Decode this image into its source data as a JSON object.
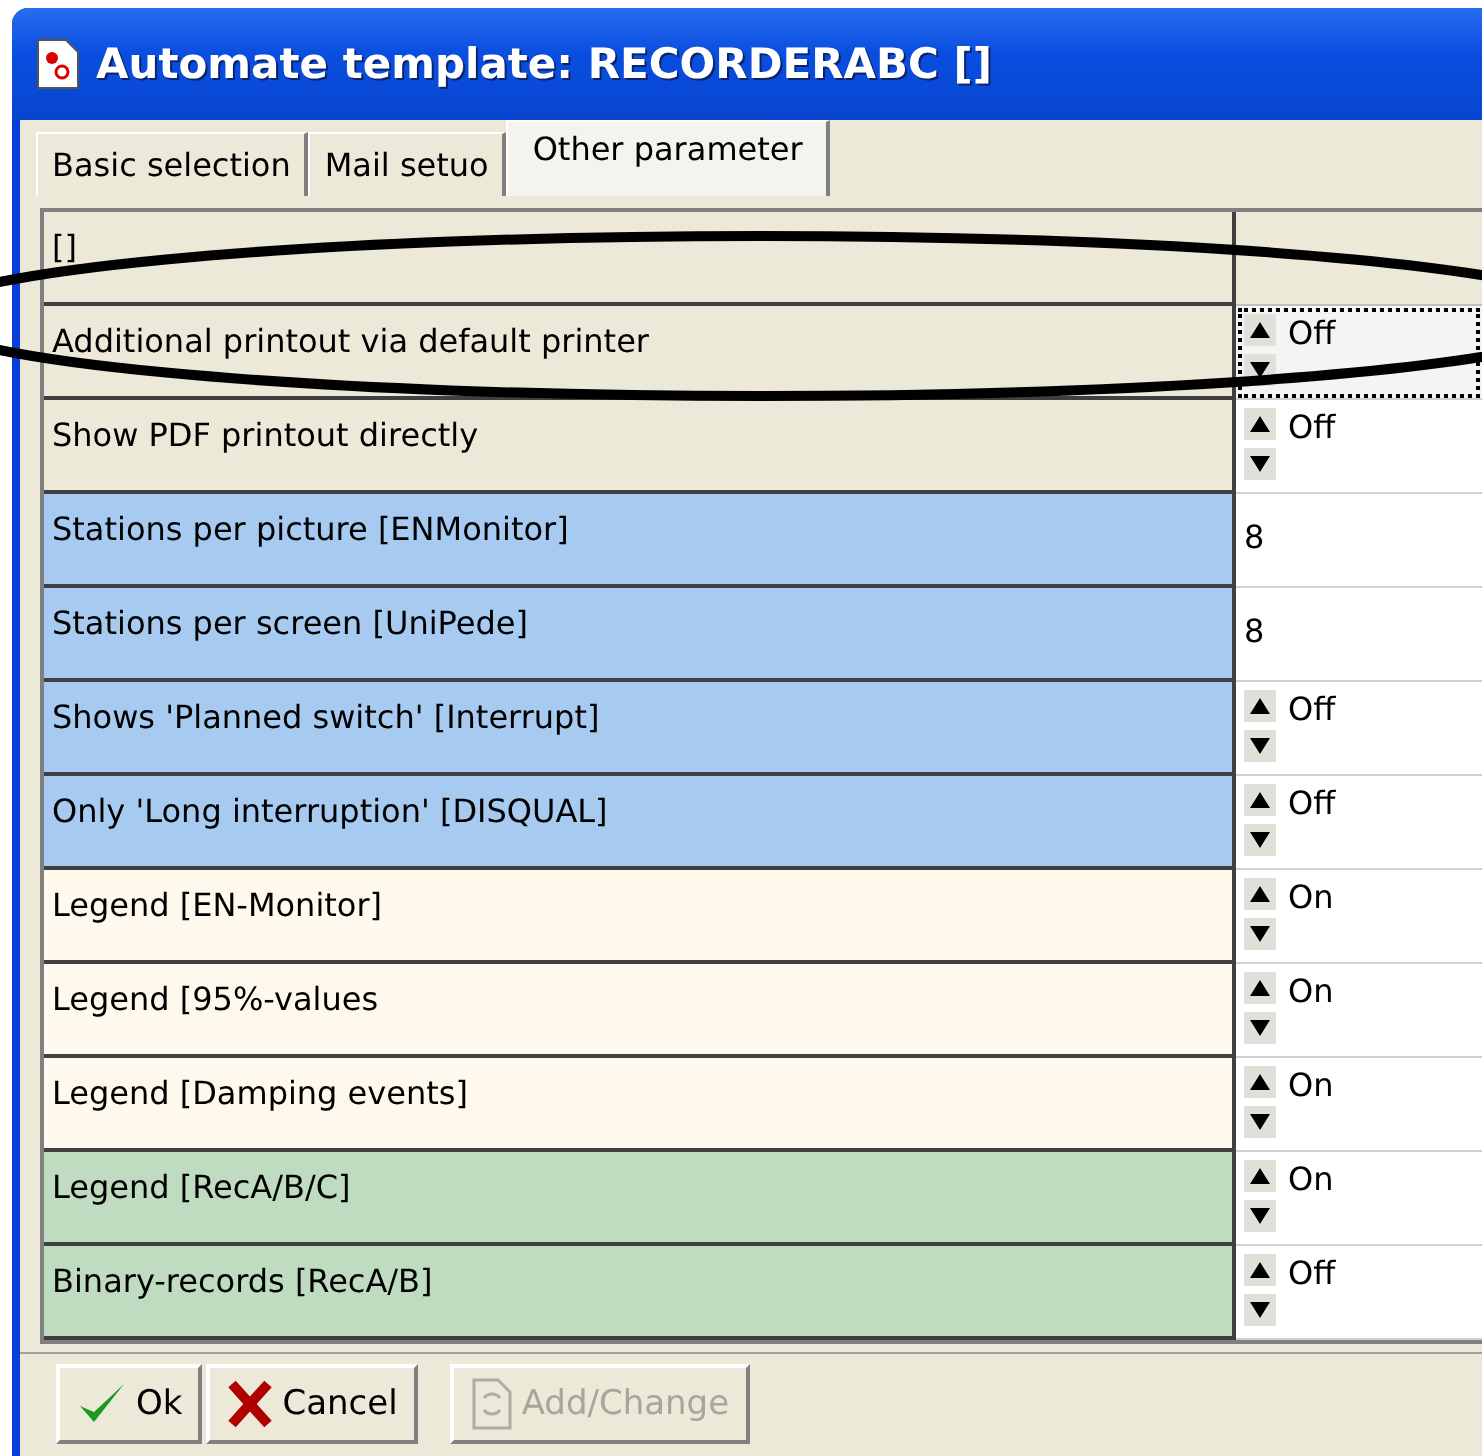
{
  "window": {
    "title": "Automate template: RECORDERABC []"
  },
  "tabs": [
    {
      "label": "Basic selection",
      "selected": false
    },
    {
      "label": "Mail setuo",
      "selected": false
    },
    {
      "label": "Other parameter",
      "selected": true
    }
  ],
  "grid": {
    "header": "[]",
    "rows": [
      {
        "label": "Additional printout via default printer",
        "kind": "spin",
        "value": "Off",
        "color": "#ece9d8",
        "focused": true
      },
      {
        "label": "Show PDF printout directly",
        "kind": "spin",
        "value": "Off",
        "color": "#ece9d8",
        "focused": false
      },
      {
        "label": "Stations per picture [ENMonitor]",
        "kind": "number",
        "value": "8",
        "color": "#a6caf0",
        "focused": false
      },
      {
        "label": "Stations per screen [UniPede]",
        "kind": "number",
        "value": "8",
        "color": "#a6caf0",
        "focused": false
      },
      {
        "label": "Shows 'Planned switch' [Interrupt]",
        "kind": "spin",
        "value": "Off",
        "color": "#a6caf0",
        "focused": false
      },
      {
        "label": "Only 'Long interruption' [DISQUAL]",
        "kind": "spin",
        "value": "Off",
        "color": "#a6caf0",
        "focused": false
      },
      {
        "label": "Legend [EN-Monitor]",
        "kind": "spin",
        "value": "On",
        "color": "#fff8ec",
        "focused": false
      },
      {
        "label": "Legend [95%-values",
        "kind": "spin",
        "value": "On",
        "color": "#fff8ec",
        "focused": false
      },
      {
        "label": "Legend [Damping events]",
        "kind": "spin",
        "value": "On",
        "color": "#fff8ec",
        "focused": false
      },
      {
        "label": "Legend [RecA/B/C]",
        "kind": "spin",
        "value": "On",
        "color": "#c0dcc0",
        "focused": false
      },
      {
        "label": "Binary-records [RecA/B]",
        "kind": "spin",
        "value": "Off",
        "color": "#c0dcc0",
        "focused": false
      }
    ]
  },
  "buttons": [
    {
      "label": "Ok",
      "kind": "ok",
      "disabled": false
    },
    {
      "label": "Cancel",
      "kind": "cancel",
      "disabled": false
    },
    {
      "label": "Add/Change",
      "kind": "change",
      "disabled": true
    }
  ]
}
